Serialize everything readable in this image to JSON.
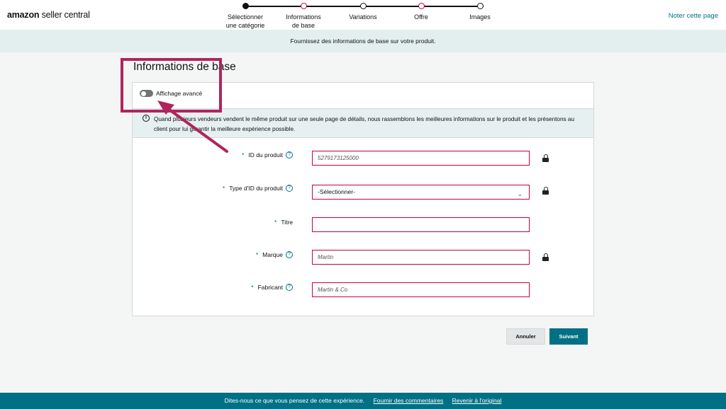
{
  "header": {
    "logo_brand": "amazon",
    "logo_rest": " seller central",
    "feedback_link": "Noter cette page"
  },
  "stepper": {
    "steps": [
      {
        "label_line1": "Sélectionner",
        "label_line2": "une catégorie",
        "state": "done"
      },
      {
        "label_line1": "Informations",
        "label_line2": "de base",
        "state": "error"
      },
      {
        "label_line1": "Variations",
        "label_line2": "",
        "state": "todo"
      },
      {
        "label_line1": "Offre",
        "label_line2": "",
        "state": "error"
      },
      {
        "label_line1": "Images",
        "label_line2": "",
        "state": "todo"
      }
    ]
  },
  "banner": {
    "text": "Fournissez des informations de base sur votre produit."
  },
  "page": {
    "title": "Informations de base"
  },
  "toggle": {
    "label": "Affichage avancé",
    "on": false
  },
  "alert": {
    "text": "Quand plusieurs vendeurs vendent le même produit sur une seule page de détails, nous rassemblons les meilleures informations sur le produit et les présentons au client pour lui garantir la meilleure expérience possible."
  },
  "form": {
    "product_id": {
      "label": "ID du produit",
      "required": "*",
      "value": "5279173125000"
    },
    "id_type": {
      "label": "Type d'ID du produit",
      "required": "*",
      "value": "-Sélectionner-"
    },
    "title": {
      "label": "Titre",
      "required": "*",
      "value": ""
    },
    "brand": {
      "label": "Marque",
      "required": "*",
      "value": "Martin"
    },
    "manufacturer": {
      "label": "Fabricant",
      "required": "*",
      "value": "Martin & Co"
    }
  },
  "actions": {
    "cancel": "Annuler",
    "next": "Suivant"
  },
  "footer": {
    "text": "Dites-nous ce que vous pensez de cette expérience.",
    "link1": "Fournir des commentaires",
    "link2": "Revenir à l'original"
  },
  "colors": {
    "accent": "#007185",
    "error": "#c40047",
    "annotation": "#b0245c"
  },
  "icons": {
    "help": "help-circle-icon",
    "lock": "lock-icon",
    "info": "info-icon",
    "chevron": "chevron-down-icon"
  }
}
